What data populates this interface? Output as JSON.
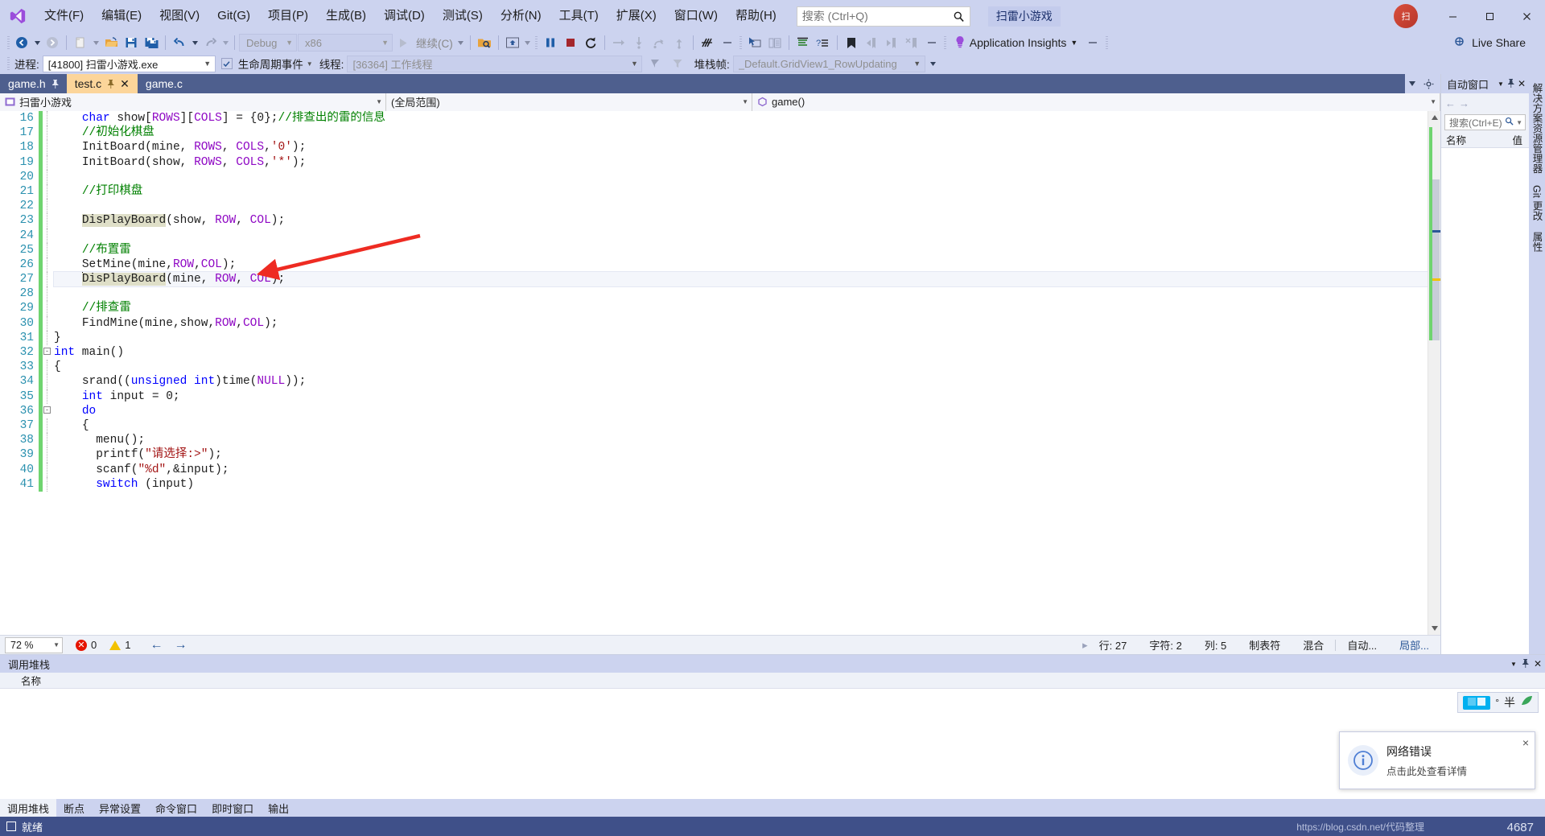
{
  "menu": {
    "logo": "vs-logo",
    "items": [
      {
        "label": "文件(F)",
        "key": "F"
      },
      {
        "label": "编辑(E)",
        "key": "E"
      },
      {
        "label": "视图(V)",
        "key": "V"
      },
      {
        "label": "Git(G)",
        "key": "G"
      },
      {
        "label": "项目(P)",
        "key": "P"
      },
      {
        "label": "生成(B)",
        "key": "B"
      },
      {
        "label": "调试(D)",
        "key": "D"
      },
      {
        "label": "测试(S)",
        "key": "S"
      },
      {
        "label": "分析(N)",
        "key": "N"
      },
      {
        "label": "工具(T)",
        "key": "T"
      },
      {
        "label": "扩展(X)",
        "key": "X"
      },
      {
        "label": "窗口(W)",
        "key": "W"
      },
      {
        "label": "帮助(H)",
        "key": "H"
      }
    ],
    "search_placeholder": "搜索 (Ctrl+Q)",
    "search_value": "",
    "project_chip": "扫雷小游戏",
    "avatar_initials": "扫"
  },
  "toolbar": {
    "config": "Debug",
    "platform": "x86",
    "continue_label": "继续(C)",
    "app_insights": "Application Insights",
    "live_share": "Live Share"
  },
  "debugbar": {
    "process_label": "进程:",
    "process_value": "[41800] 扫雷小游戏.exe",
    "lifecycle_label": "生命周期事件",
    "thread_label": "线程:",
    "thread_value": "[36364] 工作线程",
    "stack_label": "堆栈帧:",
    "stack_value": "_Default.GridView1_RowUpdating"
  },
  "tabs": [
    {
      "label": "game.h",
      "pinned": true,
      "active": false,
      "closable": false
    },
    {
      "label": "test.c",
      "pinned": true,
      "active": true,
      "closable": true
    },
    {
      "label": "game.c",
      "pinned": false,
      "active": false,
      "closable": false
    }
  ],
  "navbar": {
    "project": "扫雷小游戏",
    "scope": "(全局范围)",
    "member": "game()"
  },
  "editor": {
    "first_line": 16,
    "current_line": 27,
    "lines": [
      {
        "n": 16,
        "indent": 4,
        "tokens": [
          {
            "t": "char",
            "c": "kw"
          },
          {
            "t": " show",
            "c": "pl"
          },
          {
            "t": "[",
            "c": "pl"
          },
          {
            "t": "ROWS",
            "c": "macro"
          },
          {
            "t": "][",
            "c": "pl"
          },
          {
            "t": "COLS",
            "c": "macro"
          },
          {
            "t": "] = {0};",
            "c": "pl"
          },
          {
            "t": "//排查出的雷的信息",
            "c": "cmt"
          }
        ]
      },
      {
        "n": 17,
        "indent": 4,
        "tokens": [
          {
            "t": "//初始化棋盘",
            "c": "cmt"
          }
        ]
      },
      {
        "n": 18,
        "indent": 4,
        "tokens": [
          {
            "t": "InitBoard",
            "c": "pl"
          },
          {
            "t": "(mine, ",
            "c": "pl"
          },
          {
            "t": "ROWS",
            "c": "macro"
          },
          {
            "t": ", ",
            "c": "pl"
          },
          {
            "t": "COLS",
            "c": "macro"
          },
          {
            "t": ",",
            "c": "pl"
          },
          {
            "t": "'0'",
            "c": "str"
          },
          {
            "t": ");",
            "c": "pl"
          }
        ]
      },
      {
        "n": 19,
        "indent": 4,
        "tokens": [
          {
            "t": "InitBoard",
            "c": "pl"
          },
          {
            "t": "(show, ",
            "c": "pl"
          },
          {
            "t": "ROWS",
            "c": "macro"
          },
          {
            "t": ", ",
            "c": "pl"
          },
          {
            "t": "COLS",
            "c": "macro"
          },
          {
            "t": ",",
            "c": "pl"
          },
          {
            "t": "'*'",
            "c": "str"
          },
          {
            "t": ");",
            "c": "pl"
          }
        ]
      },
      {
        "n": 20,
        "indent": 0,
        "tokens": []
      },
      {
        "n": 21,
        "indent": 4,
        "tokens": [
          {
            "t": "//打印棋盘",
            "c": "cmt"
          }
        ]
      },
      {
        "n": 22,
        "indent": 0,
        "tokens": []
      },
      {
        "n": 23,
        "indent": 4,
        "tokens": [
          {
            "t": "DisPlayBoard",
            "c": "pl",
            "hl": true
          },
          {
            "t": "(show, ",
            "c": "pl"
          },
          {
            "t": "ROW",
            "c": "macro"
          },
          {
            "t": ", ",
            "c": "pl"
          },
          {
            "t": "COL",
            "c": "macro"
          },
          {
            "t": ");",
            "c": "pl"
          }
        ]
      },
      {
        "n": 24,
        "indent": 0,
        "tokens": []
      },
      {
        "n": 25,
        "indent": 4,
        "tokens": [
          {
            "t": "//布置雷",
            "c": "cmt"
          }
        ]
      },
      {
        "n": 26,
        "indent": 4,
        "tokens": [
          {
            "t": "SetMine",
            "c": "pl"
          },
          {
            "t": "(mine,",
            "c": "pl"
          },
          {
            "t": "ROW",
            "c": "macro"
          },
          {
            "t": ",",
            "c": "pl"
          },
          {
            "t": "COL",
            "c": "macro"
          },
          {
            "t": ");",
            "c": "pl"
          }
        ]
      },
      {
        "n": 27,
        "indent": 4,
        "current": true,
        "caret": true,
        "tokens": [
          {
            "t": "DisPlayBoard",
            "c": "pl",
            "hl": true
          },
          {
            "t": "(mine, ",
            "c": "pl"
          },
          {
            "t": "ROW",
            "c": "macro"
          },
          {
            "t": ", ",
            "c": "pl"
          },
          {
            "t": "COL",
            "c": "macro"
          },
          {
            "t": ");",
            "c": "pl"
          }
        ]
      },
      {
        "n": 28,
        "indent": 0,
        "tokens": []
      },
      {
        "n": 29,
        "indent": 4,
        "tokens": [
          {
            "t": "//排查雷",
            "c": "cmt"
          }
        ]
      },
      {
        "n": 30,
        "indent": 4,
        "tokens": [
          {
            "t": "FindMine",
            "c": "pl"
          },
          {
            "t": "(mine,show,",
            "c": "pl"
          },
          {
            "t": "ROW",
            "c": "macro"
          },
          {
            "t": ",",
            "c": "pl"
          },
          {
            "t": "COL",
            "c": "macro"
          },
          {
            "t": ");",
            "c": "pl"
          }
        ]
      },
      {
        "n": 31,
        "indent": 0,
        "tokens": [
          {
            "t": "}",
            "c": "pl"
          }
        ]
      },
      {
        "n": 32,
        "indent": 0,
        "fold": true,
        "tokens": [
          {
            "t": "int",
            "c": "kw"
          },
          {
            "t": " main()",
            "c": "pl"
          }
        ]
      },
      {
        "n": 33,
        "indent": 0,
        "tokens": [
          {
            "t": "{",
            "c": "pl"
          }
        ]
      },
      {
        "n": 34,
        "indent": 4,
        "tokens": [
          {
            "t": "srand((",
            "c": "pl"
          },
          {
            "t": "unsigned int",
            "c": "kw"
          },
          {
            "t": ")time(",
            "c": "pl"
          },
          {
            "t": "NULL",
            "c": "macro"
          },
          {
            "t": "));",
            "c": "pl"
          }
        ]
      },
      {
        "n": 35,
        "indent": 4,
        "tokens": [
          {
            "t": "int",
            "c": "kw"
          },
          {
            "t": " input = 0;",
            "c": "pl"
          }
        ]
      },
      {
        "n": 36,
        "indent": 4,
        "fold": true,
        "tokens": [
          {
            "t": "do",
            "c": "kw"
          }
        ]
      },
      {
        "n": 37,
        "indent": 4,
        "tokens": [
          {
            "t": "{",
            "c": "pl"
          }
        ]
      },
      {
        "n": 38,
        "indent": 6,
        "tokens": [
          {
            "t": "menu();",
            "c": "pl"
          }
        ]
      },
      {
        "n": 39,
        "indent": 6,
        "tokens": [
          {
            "t": "printf(",
            "c": "pl"
          },
          {
            "t": "\"请选择:>\"",
            "c": "str"
          },
          {
            "t": ");",
            "c": "pl"
          }
        ]
      },
      {
        "n": 40,
        "indent": 6,
        "tokens": [
          {
            "t": "scanf(",
            "c": "pl"
          },
          {
            "t": "\"%d\"",
            "c": "str"
          },
          {
            "t": ",&input);",
            "c": "pl"
          }
        ]
      },
      {
        "n": 41,
        "indent": 6,
        "tokens": [
          {
            "t": "switch",
            "c": "kw"
          },
          {
            "t": " (input)",
            "c": "pl"
          }
        ]
      }
    ]
  },
  "editor_status": {
    "zoom": "72 %",
    "errors": "0",
    "warnings": "1",
    "row_label": "行: 27",
    "col_char_label": "字符: 2",
    "col_label": "列: 5",
    "tab_label": "制表符",
    "mix_label": "混合",
    "auto_label": "自动...",
    "local_label": "局部..."
  },
  "right_panels": {
    "auto_title": "自动窗口",
    "search_placeholder": "搜索(Ctrl+E)",
    "col_name": "名称",
    "col_value": "值",
    "rail_items": [
      "解决方案资源管理器",
      "Git 更改",
      "属性"
    ]
  },
  "bottom_dock": {
    "title": "调用堆栈",
    "col_name": "名称",
    "tabs": [
      {
        "label": "调用堆栈",
        "active": true
      },
      {
        "label": "断点",
        "active": false
      },
      {
        "label": "异常设置",
        "active": false
      },
      {
        "label": "命令窗口",
        "active": false
      },
      {
        "label": "即时窗口",
        "active": false
      },
      {
        "label": "输出",
        "active": false
      }
    ]
  },
  "toast": {
    "title": "网络错误",
    "subtitle": "点击此处查看详情",
    "icon": "info-circle-icon",
    "close": "×"
  },
  "app_status": {
    "ready": "就绪",
    "watermark": "https://blog.csdn.net/代码整理",
    "watermark_right": "4687"
  },
  "colors": {
    "chrome": "#ccd3ef",
    "titlebar_accent": "#3f5089",
    "tab_active": "#fcd59a",
    "tabstrip": "#4e5f8e",
    "keyword": "#0000ff",
    "macro": "#8f08c4",
    "string": "#a31515",
    "comment": "#008000",
    "line_number": "#2b91af",
    "change_marker": "#6fd46f",
    "arrow": "#ee2b22"
  }
}
